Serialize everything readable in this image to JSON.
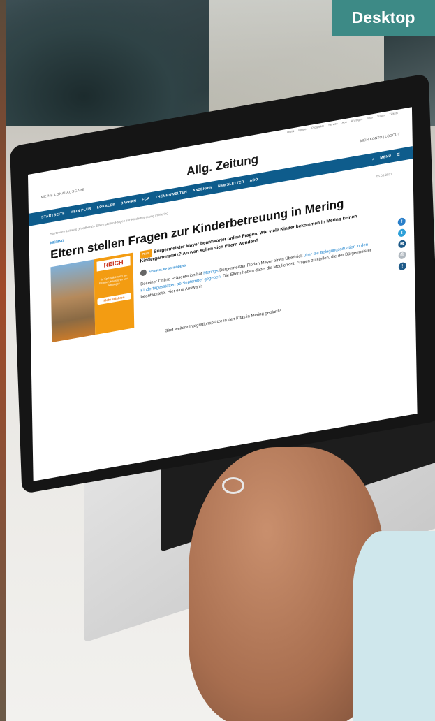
{
  "badge": {
    "label": "Desktop",
    "color": "#3d8a86"
  },
  "site": {
    "topbar_links": [
      "LOGIN",
      "Epaper",
      "Prospekte",
      "Service",
      "Abo",
      "Anzeigen",
      "Jobs",
      "Trauer",
      "Tickets"
    ],
    "lokal_label": "MEINE LOKALAUSGABE",
    "brand": "Allg. Zeitung",
    "account": "MEIN KONTO | LOGOUT",
    "nav": [
      "STARTSEITE",
      "MEIN PLUS",
      "LOKALES",
      "BAYERN",
      "FCA",
      "THEMENWELTEN",
      "ANZEIGEN",
      "NEWSLETTER",
      "ABO"
    ],
    "menu_label": "MENÜ",
    "nav_color": "#0e5c8c"
  },
  "article": {
    "breadcrumb": "Startseite › Lokales (Friedberg) › Eltern stellen Fragen zur Kinderbetreuung in Mering",
    "date": "05.05.2021",
    "kicker": "MERING",
    "headline": "Eltern stellen Fragen zur Kinderbetreuung in Mering",
    "plus_badge": "PLUS",
    "lead": "Bürgermeister Mayer beantwortet online Fragen. Wie viele Kinder bekommen in Mering keinen Kindergartenplatz? An wen sollen sich Eltern wenden?",
    "author": "VON PHILIPP SCHRÖDERS",
    "body_1": "Bei einer Online-Präsentation hat",
    "link_1": "Merings",
    "body_2": "Bürgermeister Florian Mayer einen Überblick",
    "link_2": "über die Belegungssituation in den Kindertagesstätten ab September gegeben.",
    "body_3": "Die Eltern hatten dabei die Möglichkeit, Fragen zu stellen, die der Bürgermeister beantwortete. Hier eine Auswahl:",
    "question": "Sind weitere Integrationsplätze in den Kitas in Mering geplant?",
    "ad": {
      "logo": "REICH",
      "text": "Ihr Spezialist rund um Fenster, Haustüren und Sonstiges",
      "button": "Mehr erfahren"
    },
    "share_icons": [
      {
        "name": "facebook-icon",
        "glyph": "f",
        "color": "#2a7fc9"
      },
      {
        "name": "twitter-icon",
        "glyph": "t",
        "color": "#2ea0d8"
      },
      {
        "name": "mail-icon",
        "glyph": "✉",
        "color": "#1e5a88"
      },
      {
        "name": "print-icon",
        "glyph": "⎙",
        "color": "#b0b8bf"
      },
      {
        "name": "more-icon",
        "glyph": "⋮",
        "color": "#1e5a88"
      }
    ]
  }
}
